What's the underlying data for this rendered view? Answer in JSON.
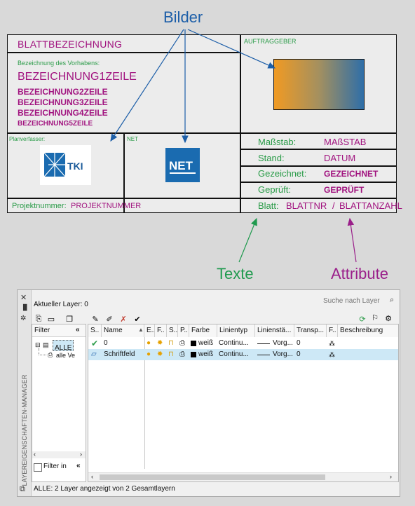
{
  "callouts": {
    "bilder": "Bilder",
    "texte": "Texte",
    "attribute": "Attribute"
  },
  "title_block": {
    "blattbezeichnung": "BLATTBEZEICHNUNG",
    "auftraggeber": "AUFTRAGGEBER",
    "bezeichnung_label": "Bezeichnung des Vorhabens:",
    "zeile1": "BEZEICHNUNG1ZEILE",
    "zeile2": "BEZEICHNUNG2ZEILE",
    "zeile3": "BEZEICHNUNG3ZEILE",
    "zeile4": "BEZEICHNUNG4ZEILE",
    "zeile5": "BEZEICHNUNG5ZEILE",
    "planverfasser_label": "Planverfasser:",
    "net_label": "NET",
    "tki_logo_text": "TKI",
    "net_logo_text": "NET",
    "projektnummer_label": "Projektnummer:",
    "projektnummer_value": "PROJEKTNUMMER",
    "massstab_label": "Maßstab:",
    "massstab_value": "MAßSTAB",
    "stand_label": "Stand:",
    "stand_value": "DATUM",
    "gezeichnet_label": "Gezeichnet:",
    "gezeichnet_value": "GEZEICHNET",
    "geprueft_label": "Geprüft:",
    "geprueft_value": "GEPRÜFT",
    "blatt_label": "Blatt:",
    "blatt_nr": "BLATTNR",
    "blatt_sep": "/",
    "blatt_anzahl": "BLATTANZAHL"
  },
  "layer_manager": {
    "side_title": "LAYEREIGENSCHAFTEN-MANAGER",
    "current_layer": "Aktueller Layer: 0",
    "search_placeholder": "Suche nach Layer",
    "filter_header": "Filter",
    "filter_collapse": "«",
    "tree_all": "ALLE",
    "tree_child": "alle Ve",
    "filter_invert": "Filter in",
    "status": "ALLE: 2 Layer angezeigt von 2 Gesamtlayern",
    "columns": [
      "S..",
      "Name",
      "E..",
      "F..",
      "S..",
      "P..",
      "Farbe",
      "Linientyp",
      "Linienstä...",
      "Transp...",
      "F..",
      "Beschreibung"
    ],
    "rows": [
      {
        "name": "0",
        "color_name": "weiß",
        "linetype": "Continu...",
        "lineweight": "Vorg...",
        "transparency": "0",
        "status": "check",
        "selected": false
      },
      {
        "name": "Schriftfeld",
        "color_name": "weiß",
        "linetype": "Continu...",
        "lineweight": "Vorg...",
        "transparency": "0",
        "status": "layer",
        "selected": true
      }
    ]
  },
  "colors": {
    "magenta": "#a1137f",
    "green": "#2a9b48",
    "blue_callout": "#1c5ea8",
    "green_callout": "#1f9a4e",
    "purple_callout": "#9a1f8a",
    "selection": "#cde8f6"
  }
}
